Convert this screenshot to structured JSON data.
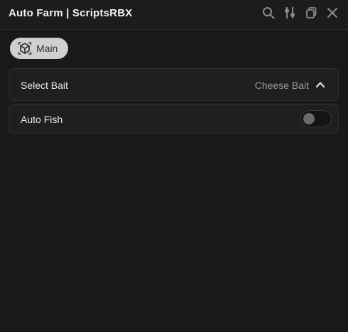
{
  "window": {
    "title": "Auto Farm | ScriptsRBX"
  },
  "titlebar": {
    "icons": [
      "search-icon",
      "sliders-icon",
      "copy-icon",
      "close-icon"
    ]
  },
  "tabs": [
    {
      "label": "Main",
      "icon": "cube-icon",
      "selected": true
    }
  ],
  "main": {
    "dropdown": {
      "label": "Select Bait",
      "value": "Cheese Bait",
      "expanded": true
    },
    "toggle": {
      "label": "Auto Fish",
      "on": false
    }
  },
  "colors": {
    "background": "#191919",
    "row_background": "#1f1f1f",
    "tab_background": "#cfcfcf",
    "text": "#e8e8e8",
    "muted_text": "#9a9a9a",
    "icon": "#8a8a8a"
  }
}
